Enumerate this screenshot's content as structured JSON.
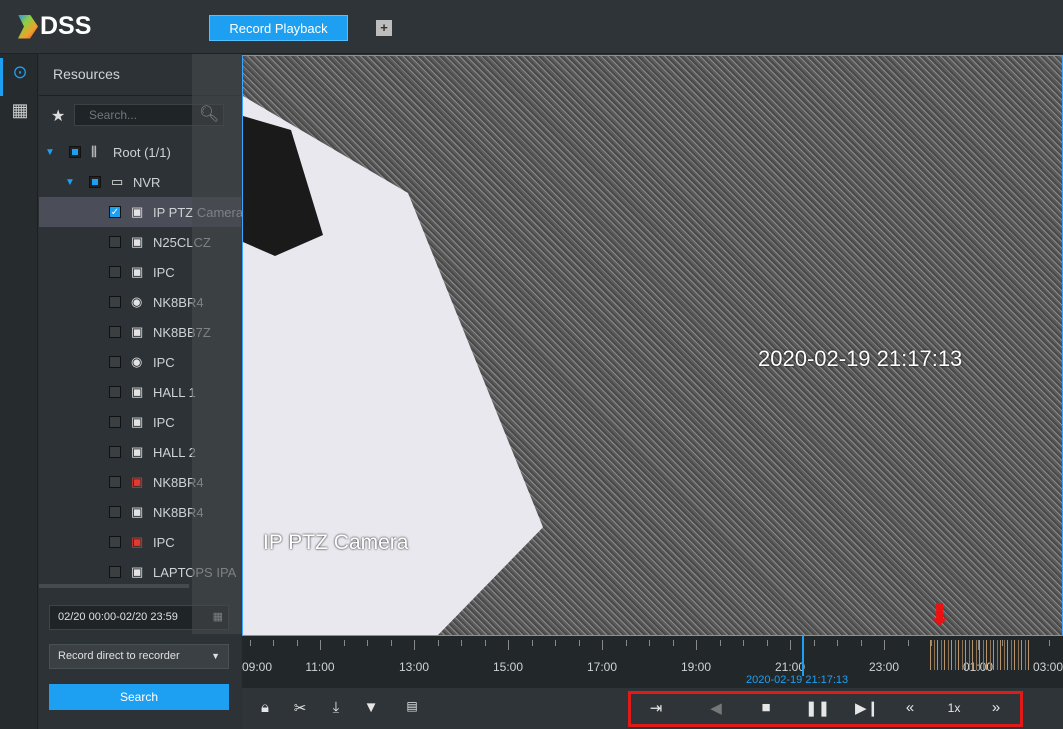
{
  "app": {
    "logo": "DSS",
    "tab": "Record Playback",
    "add_tab": "+"
  },
  "panel": {
    "title": "Resources",
    "search_placeholder": "Search...",
    "tree": [
      {
        "label": "Root (1/1)",
        "icon": "organization-icon",
        "level": 0,
        "check": "partial",
        "expand": true
      },
      {
        "label": "NVR",
        "icon": "nvr-icon",
        "level": 1,
        "check": "partial",
        "expand": true
      },
      {
        "label": "IP PTZ Camera",
        "icon": "camera-playing-icon",
        "level": 2,
        "check": "checked",
        "selected": true
      },
      {
        "label": "N25CLCZ",
        "icon": "camera-icon",
        "level": 2,
        "check": "none"
      },
      {
        "label": "IPC",
        "icon": "camera-icon",
        "level": 2,
        "check": "none"
      },
      {
        "label": "NK8BR4",
        "icon": "fisheye-icon",
        "level": 2,
        "check": "none"
      },
      {
        "label": "NK8BB7Z",
        "icon": "camera-icon",
        "level": 2,
        "check": "none"
      },
      {
        "label": "IPC",
        "icon": "fisheye-icon",
        "level": 2,
        "check": "none"
      },
      {
        "label": "HALL 1",
        "icon": "camera-icon",
        "level": 2,
        "check": "none"
      },
      {
        "label": "IPC",
        "icon": "camera-icon",
        "level": 2,
        "check": "none"
      },
      {
        "label": "HALL 2",
        "icon": "camera-icon",
        "level": 2,
        "check": "none"
      },
      {
        "label": "NK8BR4",
        "icon": "camera-offline-icon",
        "level": 2,
        "check": "none"
      },
      {
        "label": "NK8BR4",
        "icon": "camera-icon",
        "level": 2,
        "check": "none"
      },
      {
        "label": "IPC",
        "icon": "camera-offline-icon",
        "level": 2,
        "check": "none"
      },
      {
        "label": "LAPTOPS IPA",
        "icon": "camera-icon",
        "level": 2,
        "check": "none"
      }
    ],
    "date_range": "02/20 00:00-02/20 23:59",
    "record_mode": "Record direct to recorder",
    "search_button": "Search"
  },
  "video": {
    "osd_time": "2020-02-19 21:17:13",
    "osd_name": "IP PTZ Camera"
  },
  "timeline": {
    "labels": [
      "09:00",
      "11:00",
      "13:00",
      "15:00",
      "17:00",
      "19:00",
      "21:00",
      "23:00",
      "01:00",
      "03:00"
    ],
    "current": "2020-02-19 21:17:13"
  },
  "controls": {
    "speed": "1x"
  },
  "colors": {
    "accent": "#1da0f2",
    "highlight": "#e01919"
  }
}
